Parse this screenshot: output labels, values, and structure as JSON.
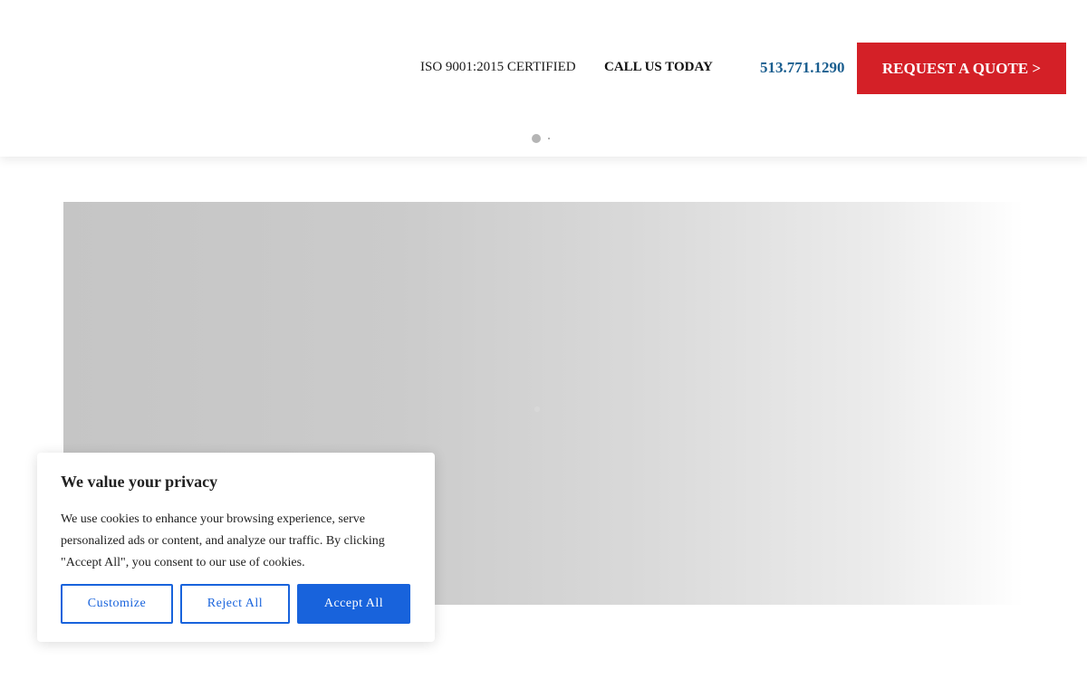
{
  "header": {
    "certification": "ISO 9001:2015 CERTIFIED",
    "call_label": "CALL US TODAY",
    "phone": "513.771.1290",
    "quote_button": "REQUEST A QUOTE >"
  },
  "cookie_banner": {
    "title": "We value your privacy",
    "text": "We use cookies to enhance your browsing experience, serve personalized ads or content, and analyze our traffic. By clicking \"Accept All\", you consent to our use of cookies.",
    "buttons": {
      "customize": "Customize",
      "reject": "Reject All",
      "accept": "Accept All"
    }
  },
  "colors": {
    "brand_red": "#d42027",
    "phone_blue": "#1a5e8f",
    "cookie_blue": "#1863dc"
  }
}
